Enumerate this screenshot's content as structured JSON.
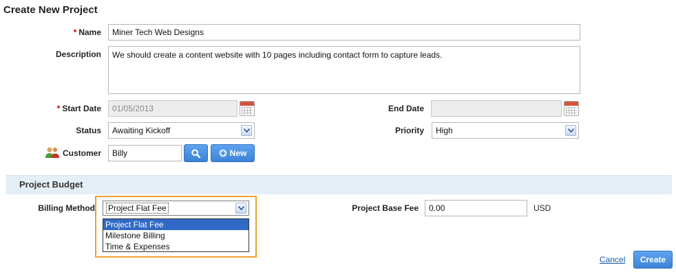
{
  "page": {
    "title": "Create New Project"
  },
  "form": {
    "required_mark": "*",
    "name": {
      "label": "Name",
      "value": "Miner Tech Web Designs"
    },
    "description": {
      "label": "Description",
      "value": "We should create a content website with 10 pages including contact form to capture leads."
    },
    "start_date": {
      "label": "Start Date",
      "value": "01/05/2013"
    },
    "end_date": {
      "label": "End Date",
      "value": ""
    },
    "status": {
      "label": "Status",
      "value": "Awaiting Kickoff"
    },
    "priority": {
      "label": "Priority",
      "value": "High"
    },
    "customer": {
      "label": "Customer",
      "value": "Billy",
      "new_label": "New"
    }
  },
  "budget": {
    "section_title": "Project Budget",
    "billing_method": {
      "label": "Billing Method",
      "value": "Project Flat Fee",
      "options": [
        "Project Flat Fee",
        "Milestone Billing",
        "Time & Expenses"
      ]
    },
    "base_fee": {
      "label": "Project Base Fee",
      "value": "0.00",
      "currency": "USD"
    }
  },
  "actions": {
    "cancel_label": "Cancel",
    "create_label": "Create"
  },
  "colors": {
    "accent": "#3c84d9",
    "highlight": "#f0a030",
    "section_bg": "#e4eef6",
    "required": "#cc0000"
  }
}
